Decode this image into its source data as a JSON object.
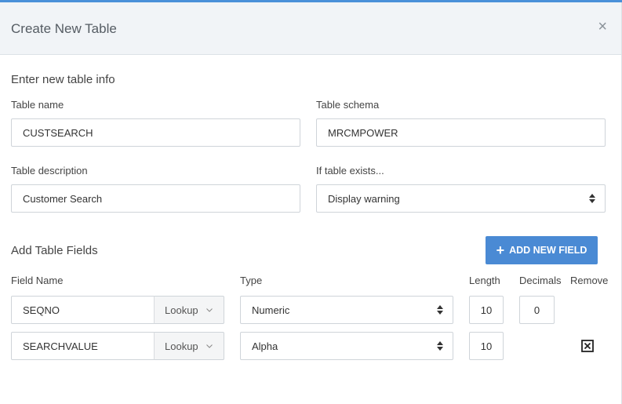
{
  "dialog": {
    "title": "Create New Table",
    "close_glyph": "×"
  },
  "table_info": {
    "section_title": "Enter new table info",
    "table_name_label": "Table name",
    "table_name_value": "CUSTSEARCH",
    "table_schema_label": "Table schema",
    "table_schema_value": "MRCMPOWER",
    "table_description_label": "Table description",
    "table_description_value": "Customer Search",
    "if_exists_label": "If table exists...",
    "if_exists_value": "Display warning"
  },
  "fields": {
    "section_title": "Add Table Fields",
    "add_button_icon": "+",
    "add_button_label": "ADD NEW FIELD",
    "headers": {
      "field_name": "Field Name",
      "type": "Type",
      "length": "Length",
      "decimals": "Decimals",
      "remove": "Remove"
    },
    "rows": [
      {
        "field_name": "SEQNO",
        "lookup_label": "Lookup",
        "type": "Numeric",
        "length": "10",
        "decimals": "0"
      },
      {
        "field_name": "SEARCHVALUE",
        "lookup_label": "Lookup",
        "type": "Alpha",
        "length": "10"
      }
    ]
  },
  "colors": {
    "accent": "#4a90d9",
    "button": "#4a8ad4",
    "header_bg": "#f1f4f7",
    "border": "#cfd4d9"
  },
  "icons": {
    "close": "close-icon",
    "select": "select-arrows-icon",
    "lookup": "chevron-down-icon",
    "add": "plus-icon",
    "remove": "remove-box-icon"
  }
}
